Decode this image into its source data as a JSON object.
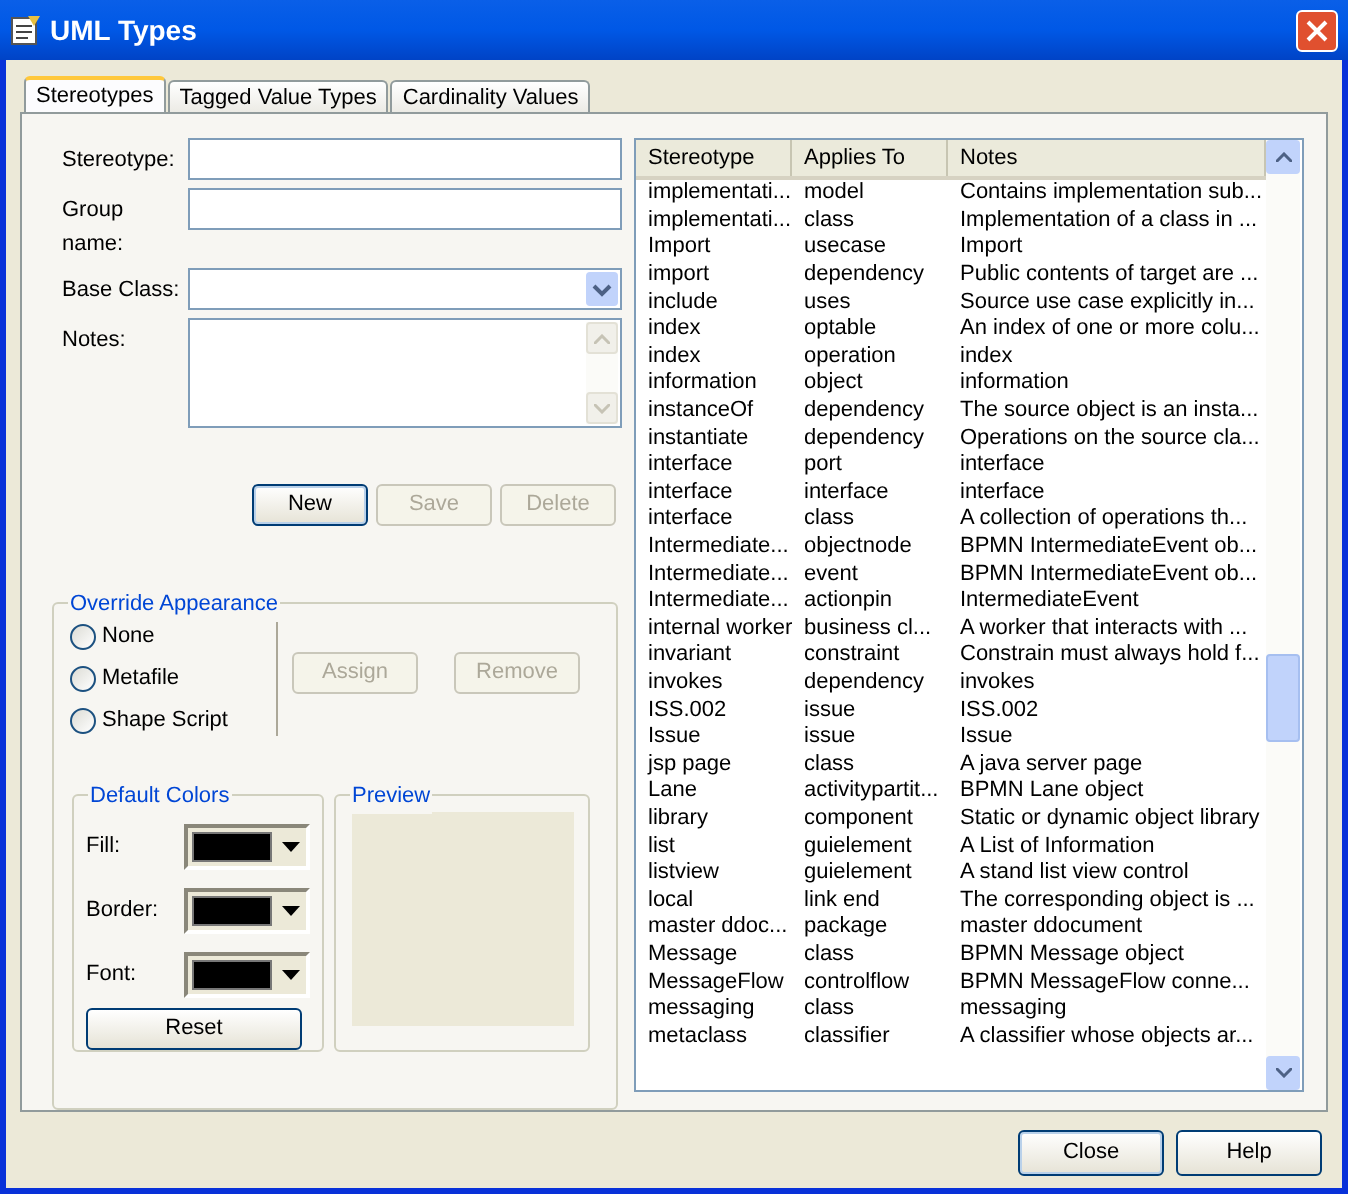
{
  "window": {
    "title": "UML Types"
  },
  "tabs": [
    {
      "label": "Stereotypes",
      "selected": true
    },
    {
      "label": "Tagged Value Types",
      "selected": false
    },
    {
      "label": "Cardinality Values",
      "selected": false
    }
  ],
  "form": {
    "fields": [
      {
        "label": "Stereotype:",
        "kind": "text"
      },
      {
        "label": "Group name:",
        "kind": "text"
      },
      {
        "label": "Base Class:",
        "kind": "dropdown"
      },
      {
        "label": "Notes:",
        "kind": "memo"
      }
    ],
    "buttons": [
      {
        "label": "New",
        "disabled": false
      },
      {
        "label": "Save",
        "disabled": true
      },
      {
        "label": "Delete",
        "disabled": true
      }
    ]
  },
  "override_appearance": {
    "title": "Override Appearance",
    "options": [
      {
        "label": "None",
        "selected": false
      },
      {
        "label": "Metafile",
        "selected": false
      },
      {
        "label": "Shape Script",
        "selected": false
      }
    ],
    "buttons": [
      {
        "label": "Assign",
        "disabled": true
      },
      {
        "label": "Remove",
        "disabled": true
      }
    ]
  },
  "default_colors": {
    "title": "Default Colors",
    "pickers": [
      {
        "label": "Fill:",
        "color": "#000000"
      },
      {
        "label": "Border:",
        "color": "#000000"
      },
      {
        "label": "Font:",
        "color": "#000000"
      }
    ],
    "reset": "Reset"
  },
  "preview": {
    "title": "Preview"
  },
  "table": {
    "columns": [
      "Stereotype",
      "Applies To",
      "Notes"
    ],
    "rows": [
      [
        "implementati...",
        "model",
        "Contains implementation sub..."
      ],
      [
        "implementati...",
        "class",
        "Implementation of a class in ..."
      ],
      [
        "Import",
        "usecase",
        "Import"
      ],
      [
        "import",
        "dependency",
        "Public contents of target are ..."
      ],
      [
        "include",
        "uses",
        "Source use case explicitly in..."
      ],
      [
        "index",
        "optable",
        "An index of one or more colu..."
      ],
      [
        "index",
        "operation",
        "index"
      ],
      [
        "information",
        "object",
        "information"
      ],
      [
        "instanceOf",
        "dependency",
        "The source object is an insta..."
      ],
      [
        "instantiate",
        "dependency",
        "Operations on the source cla..."
      ],
      [
        "interface",
        "port",
        "interface"
      ],
      [
        "interface",
        "interface",
        "interface"
      ],
      [
        "interface",
        "class",
        "A collection of operations th..."
      ],
      [
        "Intermediate...",
        "objectnode",
        "BPMN IntermediateEvent ob..."
      ],
      [
        "Intermediate...",
        "event",
        "BPMN IntermediateEvent ob..."
      ],
      [
        "Intermediate...",
        "actionpin",
        "IntermediateEvent"
      ],
      [
        "internal worker",
        "business cl...",
        "A worker that interacts with ..."
      ],
      [
        "invariant",
        "constraint",
        "Constrain must always hold f..."
      ],
      [
        "invokes",
        "dependency",
        "invokes"
      ],
      [
        "ISS.002",
        "issue",
        "ISS.002"
      ],
      [
        "Issue",
        "issue",
        "Issue"
      ],
      [
        "jsp page",
        "class",
        "A java server page"
      ],
      [
        "Lane",
        "activitypartit...",
        "BPMN Lane object"
      ],
      [
        "library",
        "component",
        "Static or dynamic object library"
      ],
      [
        "list",
        "guielement",
        "A List of Information"
      ],
      [
        "listview",
        "guielement",
        "A stand list view control"
      ],
      [
        "local",
        "link end",
        "The corresponding object is ..."
      ],
      [
        "master ddoc...",
        "package",
        "master ddocument"
      ],
      [
        "Message",
        "class",
        "BPMN Message object"
      ],
      [
        "MessageFlow",
        "controlflow",
        "BPMN MessageFlow conne..."
      ],
      [
        "messaging",
        "class",
        "messaging"
      ],
      [
        "metaclass",
        "classifier",
        "A classifier whose objects ar..."
      ]
    ]
  },
  "footer_buttons": [
    "Close",
    "Help"
  ]
}
